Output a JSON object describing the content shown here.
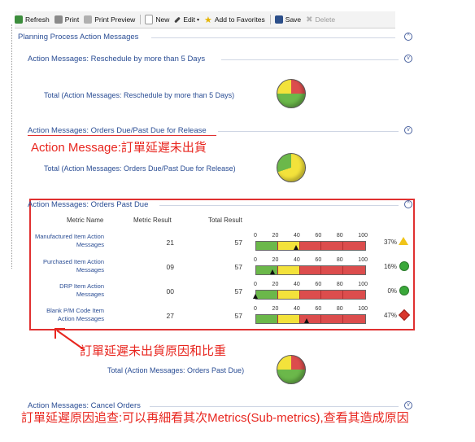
{
  "toolbar": {
    "refresh": "Refresh",
    "print": "Print",
    "print_preview": "Print Preview",
    "new": "New",
    "edit": "Edit",
    "add_favorites": "Add to Favorites",
    "save": "Save",
    "delete": "Delete"
  },
  "page_title": "Planning Process Action Messages",
  "sections": {
    "reschedule": {
      "title": "Action Messages: Reschedule by more than 5 Days",
      "total": "Total (Action Messages: Reschedule by more than 5 Days)"
    },
    "due": {
      "title": "Action Messages: Orders Due/Past Due for Release",
      "total": "Total (Action Messages: Orders Due/Past Due for Release)"
    },
    "past_due": {
      "title": "Action Messages: Orders Past Due",
      "total": "Total (Action Messages: Orders Past Due)"
    },
    "cancel": {
      "title": "Action Messages: Cancel Orders"
    }
  },
  "notes": {
    "action_message": "Action  Message:訂單延遲未出貨",
    "reason_weight": "訂單延遲未出貨原因和比重",
    "drilldown": "訂單延遲原因追查:可以再細看其次Metrics(Sub-metrics),查看其造成原因"
  },
  "table": {
    "headers": [
      "Metric Name",
      "Metric Result",
      "Total Result"
    ],
    "scale": [
      "0",
      "20",
      "40",
      "60",
      "80",
      "100"
    ],
    "rows": [
      {
        "name": "Manufactured Item Action Messages",
        "result": "21",
        "total": "57",
        "pct": "37%",
        "pct_value": 37,
        "status": "warning"
      },
      {
        "name": "Purchased Item Action Messages",
        "result": "09",
        "total": "57",
        "pct": "16%",
        "pct_value": 16,
        "status": "ok"
      },
      {
        "name": "DRP Item Action Messages",
        "result": "00",
        "total": "57",
        "pct": "0%",
        "pct_value": 0,
        "status": "ok"
      },
      {
        "name": "Blank P/M Code Item Action Messages",
        "result": "27",
        "total": "57",
        "pct": "47%",
        "pct_value": 47,
        "status": "bad"
      }
    ]
  },
  "colors": {
    "green": "#6bb84a",
    "yellow": "#f3e23b",
    "red": "#dc4d4d",
    "note_red": "#e8261f",
    "link_blue": "#2a4d94"
  }
}
